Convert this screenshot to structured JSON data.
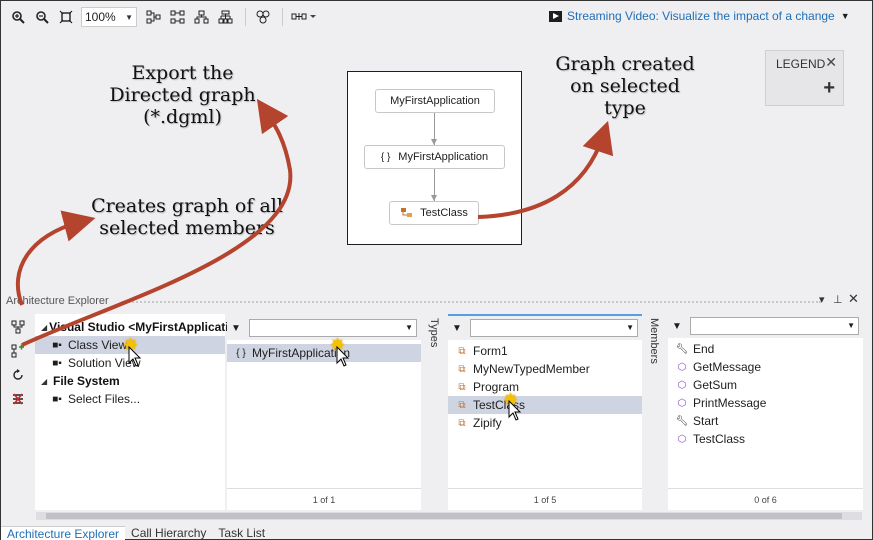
{
  "toolbar": {
    "zoom_value": "100%",
    "streaming_label": "Streaming Video: Visualize the impact of a change"
  },
  "graph": {
    "nodes": [
      "MyFirstApplication",
      "MyFirstApplication",
      "TestClass"
    ]
  },
  "legend": {
    "title": "LEGEND"
  },
  "annotations": {
    "export": "Export the\nDirected graph\n(*.dgml)",
    "creates": "Creates graph of all\nselected members",
    "created": "Graph created\non selected\ntype"
  },
  "explorer": {
    "title": "Architecture Explorer",
    "tree": [
      {
        "label": "Visual Studio <MyFirstApplicatic",
        "level": 0
      },
      {
        "label": "Class View",
        "level": 1,
        "selected": true
      },
      {
        "label": "Solution View",
        "level": 1
      },
      {
        "label": "File System",
        "level": 0
      },
      {
        "label": "Select Files...",
        "level": 1
      }
    ],
    "namespaces": {
      "items": [
        "MyFirstApplication"
      ],
      "footer": "1 of 1"
    },
    "types": {
      "tab": "Types",
      "items": [
        "Form1",
        "MyNewTypedMember",
        "Program",
        "TestClass",
        "Zipify"
      ],
      "selected_index": 3,
      "footer": "1 of 5"
    },
    "members": {
      "tab": "Members",
      "items": [
        "End",
        "GetMessage",
        "GetSum",
        "PrintMessage",
        "Start",
        "TestClass"
      ],
      "footer": "0 of 6"
    }
  },
  "bottom_tabs": [
    "Architecture Explorer",
    "Call Hierarchy",
    "Task List"
  ]
}
